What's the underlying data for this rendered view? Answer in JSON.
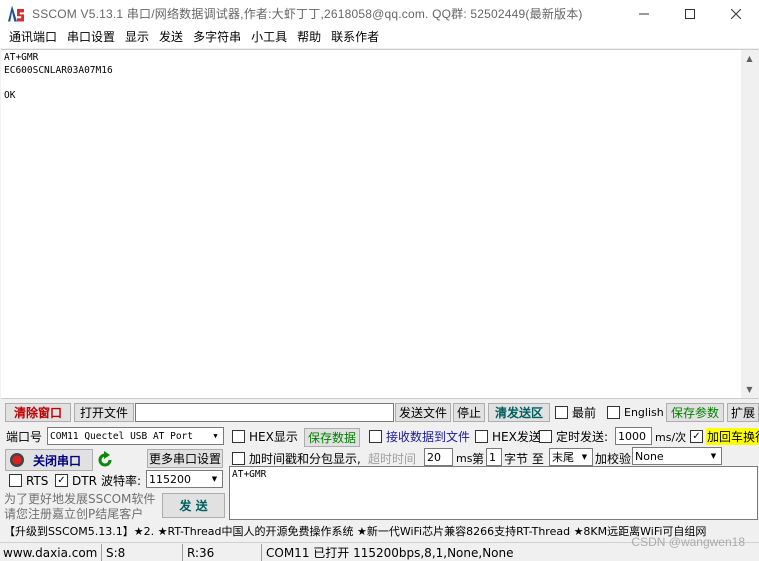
{
  "window": {
    "title": "SSCOM V5.13.1 串口/网络数据调试器,作者:大虾丁丁,2618058@qq.com. QQ群: 52502449(最新版本)",
    "minimize_icon": "minimize-icon",
    "maximize_icon": "maximize-icon",
    "close_icon": "close-icon"
  },
  "menu": [
    "通讯端口",
    "串口设置",
    "显示",
    "发送",
    "多字符串",
    "小工具",
    "帮助",
    "联系作者"
  ],
  "receive": {
    "lines": [
      "AT+GMR",
      "EC600SCNLAR03A07M16",
      "",
      "OK"
    ]
  },
  "toolbar": {
    "clear_window": "清除窗口",
    "open_file": "打开文件",
    "file_path": "",
    "send_file": "发送文件",
    "stop": "停止",
    "clear_send": "清发送区",
    "topmost": "最前",
    "english": "English",
    "save_params": "保存参数",
    "expand": "扩展"
  },
  "port": {
    "port_label": "端口号",
    "port_value": "COM11 Quectel USB AT Port",
    "hex_display": "HEX显示",
    "save_data": "保存数据",
    "recv_to_file": "接收数据到文件",
    "hex_send": "HEX发送",
    "timed_send": "定时发送:",
    "interval": "1000",
    "interval_unit": "ms/次",
    "append_crlf": "加回车换行",
    "close_port": "关闭串口",
    "more_settings": "更多串口设置",
    "timestamp": "加时间戳和分包显示,",
    "timeout_label": "超时时间",
    "timeout_value": "20",
    "timeout_unit": "ms",
    "byte_prefix": "第",
    "byte_index": "1",
    "byte_suffix": "字节 至",
    "byte_end": "末尾",
    "checksum_label": "加校验",
    "checksum_value": "None",
    "rts": "RTS",
    "dtr": "DTR",
    "baud_label": "波特率:",
    "baud_value": "115200",
    "promo_line1": "为了更好地发展SSCOM软件",
    "promo_line2": "请您注册嘉立创P结尾客户",
    "send": "发  送",
    "send_text": "AT+GMR"
  },
  "marquee": "【升级到SSCOM5.13.1】★2. ★RT-Thread中国人的开源免费操作系统 ★新一代WiFi芯片兼容8266支持RT-Thread ★8KM远距离WiFi可自组网",
  "status": {
    "website": "www.daxia.com",
    "sent": "S:8",
    "received": "R:36",
    "port_state": "COM11 已打开  115200bps,8,1,None,None"
  },
  "watermark": "CSDN @wangwen18",
  "colors": {
    "accent_red": "#c00000",
    "accent_green": "#008000",
    "crlf_highlight": "#ffff00"
  }
}
